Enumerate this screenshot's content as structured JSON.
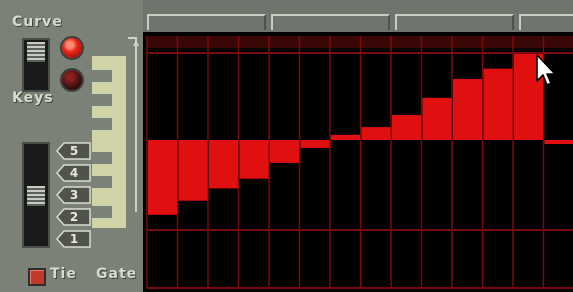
{
  "labels": {
    "curve": "Curve",
    "keys": "Keys",
    "tie": "Tie",
    "gate": "Gate"
  },
  "octave_buttons": [
    "5",
    "4",
    "3",
    "2",
    "1"
  ],
  "colors": {
    "panel": "#7c8178",
    "grid_background": "#000000",
    "grid_lines": "#7a0b0b",
    "bar": "#e01010",
    "led_on": "#e8241a",
    "led_off": "#3a1010"
  },
  "curve_steps": [
    -0.85,
    -0.69,
    -0.55,
    -0.44,
    -0.26,
    -0.09,
    0.06,
    0.15,
    0.29,
    0.49,
    0.71,
    0.83,
    1.0,
    -0.04
  ],
  "icons": {
    "cursor": "arrow-pointer-icon",
    "tie_led": "led-square-icon",
    "curve_led": "led-round-icon"
  }
}
